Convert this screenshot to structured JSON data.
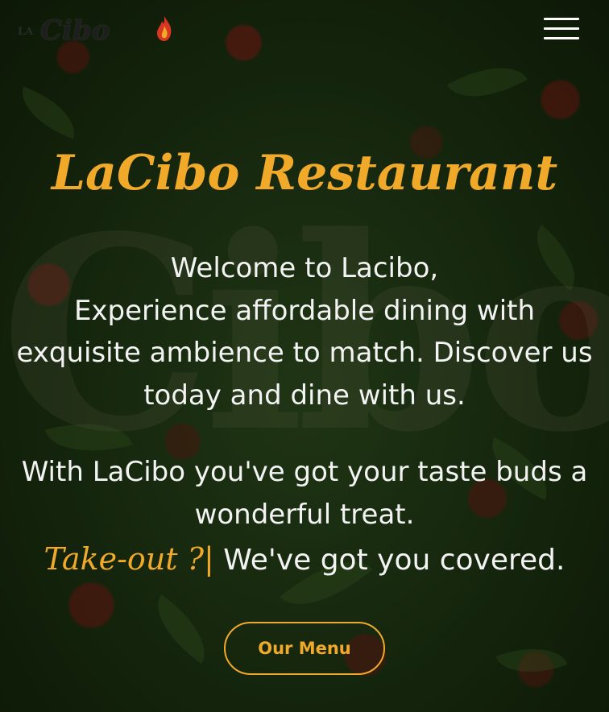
{
  "header": {
    "logo": {
      "small_text": "LA",
      "main_text": "Cibo"
    },
    "menu_toggle_icon": "hamburger-icon"
  },
  "hero": {
    "background_icon": "flower-wall-image",
    "background_letters": "Cibo",
    "title": "LaCibo Restaurant",
    "welcome_lines": [
      "Welcome to Lacibo,",
      "Experience affordable dining with exquisite ambience to match. Discover us today and dine with us."
    ],
    "treat_text": "With LaCibo you've got your taste buds a wonderful treat.",
    "takeout_highlight": "Take-out ?|",
    "takeout_text": "We've got you covered.",
    "menu_button_label": "Our Menu"
  },
  "colors": {
    "accent": "#f1a92a",
    "text": "#f3f3f3",
    "menu_icon": "#ffffff"
  }
}
